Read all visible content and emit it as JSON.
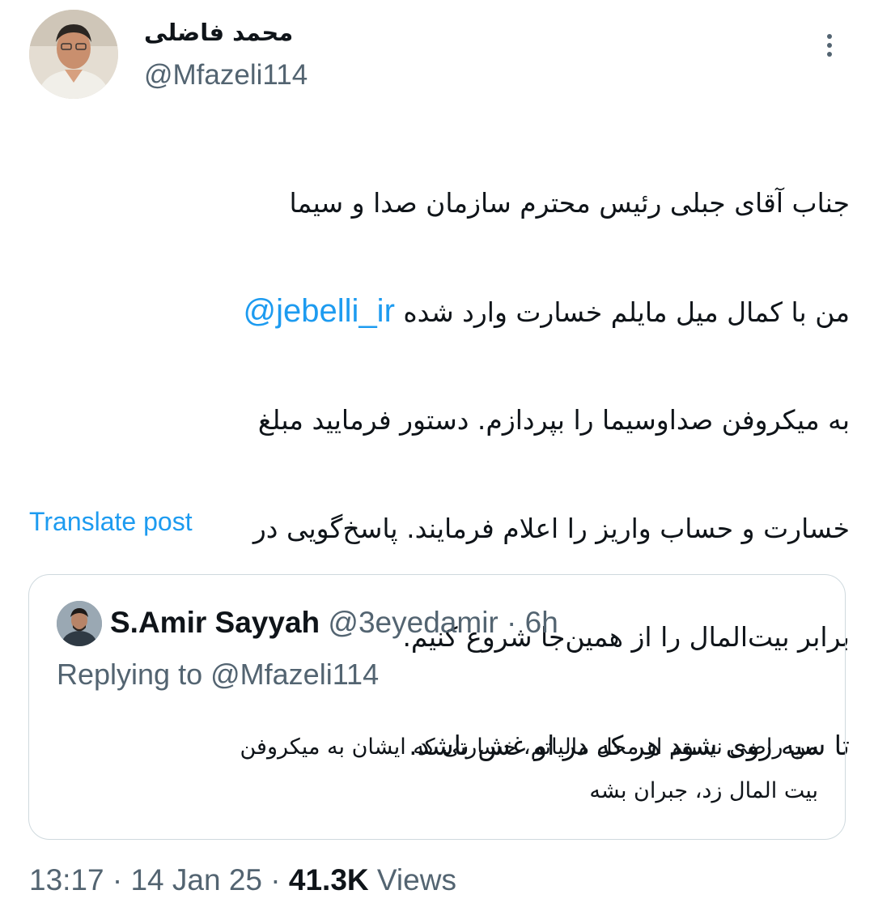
{
  "author": {
    "display_name": "محمد فاضلی",
    "handle": "@Mfazeli114",
    "avatar_icon": "person-photo-avatar"
  },
  "more_icon": "more-vertical-icon",
  "tweet": {
    "lines": [
      "جناب آقای جبلی رئیس محترم سازمان صدا و سیما",
      "من با کمال میل مایلم خسارت وارد شده",
      "به میکروفن صداوسیما را بپردازم. دستور فرمایید مبلغ",
      "خسارت و حساب واریز را اعلام فرمایند. پاسخ‌گویی در",
      "برابر بیت‌المال را از همین‌جا شروع کنیم.",
      "تا سیه روی شود هر که در او غش باشد."
    ],
    "mention": "@jebelli_ir"
  },
  "translate_label": "Translate post",
  "quoted": {
    "name": "S.Amir Sayyah",
    "handle": "@3eyedamir",
    "separator": "·",
    "time": "6h",
    "replying_prefix": "Replying to",
    "replying_handle": "@Mfazeli114",
    "text_lines": [
      "من راضی نیستم از محل مالیاتم، خسارتی که ایشان به میکروفن",
      "بیت المال زد، جبران بشه"
    ]
  },
  "meta": {
    "time": "13:17",
    "sep1": "·",
    "date": "14 Jan 25",
    "sep2": "·",
    "views_count": "41.3K",
    "views_label": "Views"
  },
  "colors": {
    "link": "#1d9bf0",
    "text": "#0f1419",
    "secondary": "#536471",
    "border": "#cfd9de"
  }
}
